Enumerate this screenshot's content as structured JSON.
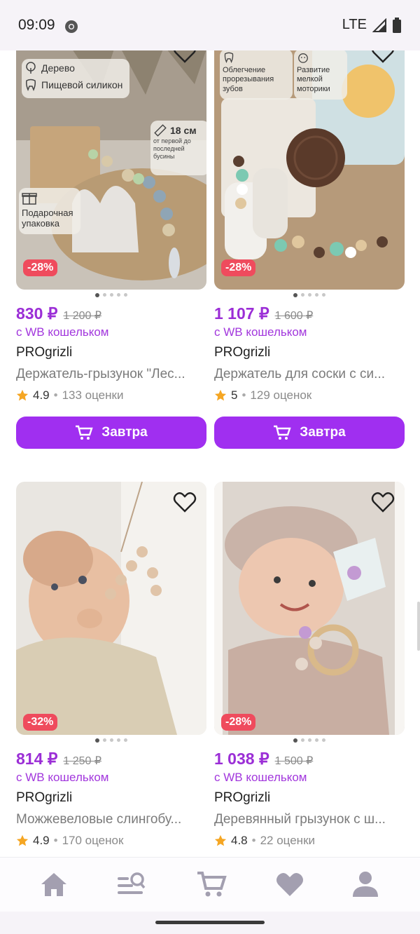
{
  "status": {
    "time": "09:09",
    "network": "LTE"
  },
  "colors": {
    "accent": "#a02ff0",
    "price": "#9b2ed6",
    "discount": "#ef4b5d",
    "star": "#f5a623"
  },
  "products": [
    {
      "discount": "-28%",
      "price": "830 ₽",
      "old_price": "1 200 ₽",
      "wallet": "с WB кошельком",
      "brand": "PROgrizli",
      "title": "Держатель-грызунок \"Лес...",
      "rating": "4.9",
      "reviews": "133 оценки",
      "button": "Завтра",
      "overlay": {
        "material1": "Дерево",
        "material2": "Пищевой силикон",
        "length": "18 см",
        "length_note": "от первой до последней бусины",
        "gift": "Подарочная упаковка"
      }
    },
    {
      "discount": "-28%",
      "price": "1 107 ₽",
      "old_price": "1 600 ₽",
      "wallet": "с WB кошельком",
      "brand": "PROgrizli",
      "title": "Держатель для соски с си...",
      "rating": "5",
      "reviews": "129 оценок",
      "button": "Завтра",
      "overlay": {
        "feature1": "Облегчение прорезывания зубов",
        "feature2": "Развитие мелкой моторики"
      }
    },
    {
      "discount": "-32%",
      "price": "814 ₽",
      "old_price": "1 250 ₽",
      "wallet": "с WB кошельком",
      "brand": "PROgrizli",
      "title": "Можжевеловые слингобу...",
      "rating": "4.9",
      "reviews": "170 оценок"
    },
    {
      "discount": "-28%",
      "price": "1 038 ₽",
      "old_price": "1 500 ₽",
      "wallet": "с WB кошельком",
      "brand": "PROgrizli",
      "title": "Деревянный грызунок с ш...",
      "rating": "4.8",
      "reviews": "22 оценки"
    }
  ],
  "nav": [
    "home-icon",
    "catalog-search-icon",
    "cart-icon",
    "favorites-icon",
    "profile-icon"
  ]
}
